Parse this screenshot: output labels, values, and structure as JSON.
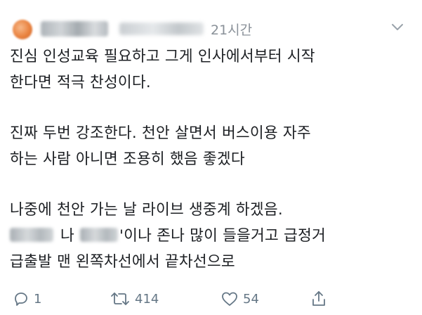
{
  "tweet": {
    "time": "21시간",
    "lines": [
      "진심 인성교육 필요하고 그게 인사에서부터 시작",
      "한다면 적극 찬성이다.",
      "진짜 두번 강조한다. 천안 살면서 버스이용 자주",
      "하는 사람 아니면 조용히 했음 좋겠다",
      "나중에 천안 가는 날 라이브 생중계 하겠음.",
      "급출발 맨 왼쪽차선에서 끝차선으로"
    ],
    "line7_part1": "나",
    "line7_part2": "'이나 존나 많이 들을거고 급정거"
  },
  "actions": {
    "reply_count": "1",
    "retweet_count": "414",
    "like_count": "54"
  },
  "icons": {
    "chevron": "chevron-down-icon",
    "reply": "reply-icon",
    "retweet": "retweet-icon",
    "like": "heart-icon",
    "share": "share-icon"
  },
  "colors": {
    "text": "#1c1f23",
    "muted": "#657786",
    "time": "#8a9199"
  }
}
